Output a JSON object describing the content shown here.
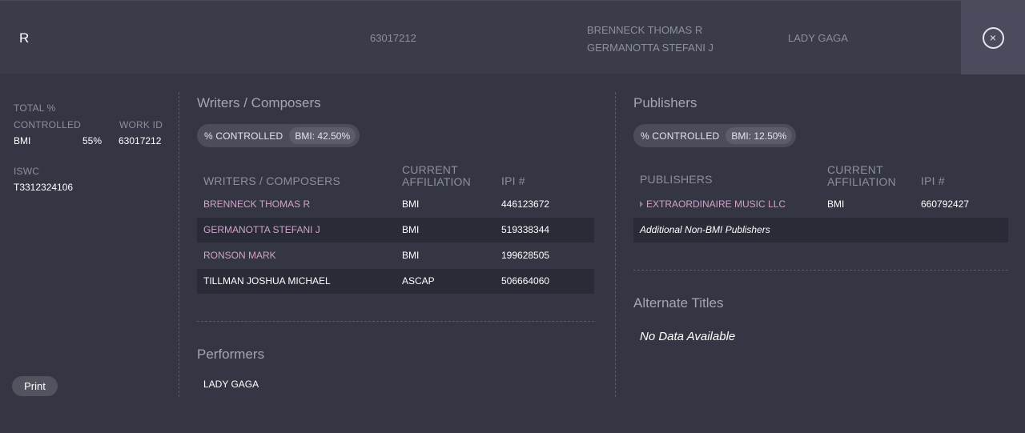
{
  "header": {
    "title": "R",
    "work_id": "63017212",
    "writers": [
      "BRENNECK THOMAS R",
      "GERMANOTTA STEFANI J"
    ],
    "performer": "LADY GAGA",
    "close_label": "×"
  },
  "info": {
    "total_label": "TOTAL %",
    "controlled_label": "CONTROLLED",
    "work_id_label": "WORK ID",
    "org": "BMI",
    "percent": "55%",
    "work_id": "63017212",
    "iswc_label": "ISWC",
    "iswc": "T3312324106"
  },
  "print_label": "Print",
  "writers_section": {
    "title": "Writers / Composers",
    "pill_label": "% CONTROLLED",
    "pill_value": "BMI: 42.50%",
    "columns": [
      "WRITERS / COMPOSERS",
      "CURRENT AFFILIATION",
      "IPI #"
    ],
    "rows": [
      {
        "name": "BRENNECK THOMAS R",
        "affiliation": "BMI",
        "ipi": "446123672"
      },
      {
        "name": "GERMANOTTA STEFANI J",
        "affiliation": "BMI",
        "ipi": "519338344"
      },
      {
        "name": "RONSON MARK",
        "affiliation": "BMI",
        "ipi": "199628505"
      },
      {
        "name": "TILLMAN JOSHUA MICHAEL",
        "affiliation": "ASCAP",
        "ipi": "506664060"
      }
    ]
  },
  "performers_section": {
    "title": "Performers",
    "items": [
      "LADY GAGA"
    ]
  },
  "publishers_section": {
    "title": "Publishers",
    "pill_label": "% CONTROLLED",
    "pill_value": "BMI: 12.50%",
    "columns": [
      "PUBLISHERS",
      "CURRENT AFFILIATION",
      "IPI #"
    ],
    "rows": [
      {
        "name": "EXTRAORDINAIRE MUSIC LLC",
        "affiliation": "BMI",
        "ipi": "660792427"
      }
    ],
    "additional_label": "Additional Non-BMI Publishers"
  },
  "alternate_titles_section": {
    "title": "Alternate Titles",
    "empty_text": "No Data Available"
  },
  "colors": {
    "background": "#343643",
    "header": "#3a3c4a",
    "link": "#cfa3c9",
    "muted": "#8d8f9d"
  }
}
